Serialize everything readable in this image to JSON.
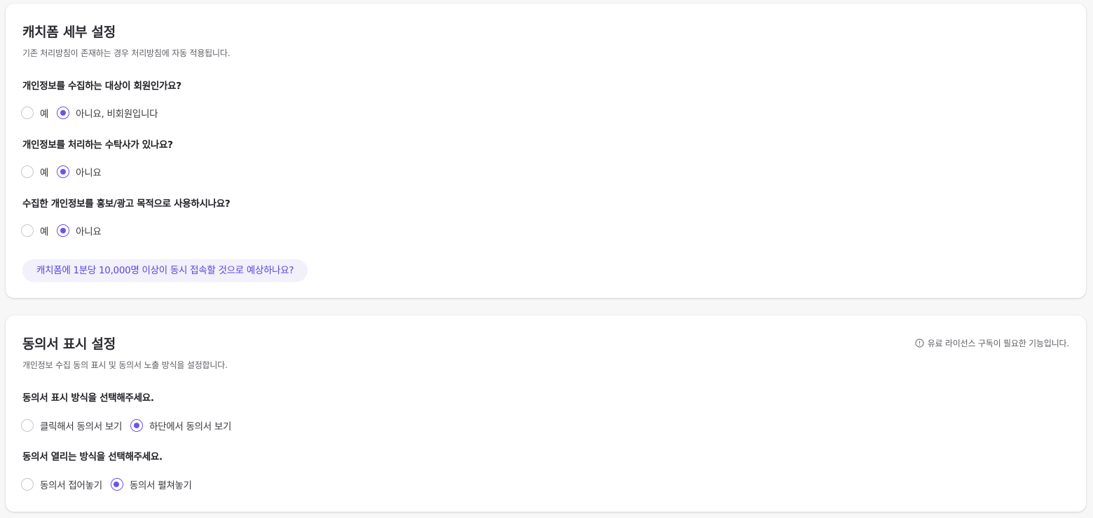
{
  "section1": {
    "title": "캐치폼 세부 설정",
    "description": "기존 처리방침이 존재하는 경우 처리방침에 자동 적용됩니다.",
    "questions": [
      {
        "label": "개인정보를 수집하는 대상이 회원인가요?",
        "options": [
          {
            "label": "예",
            "checked": false
          },
          {
            "label": "아니요, 비회원입니다",
            "checked": true
          }
        ]
      },
      {
        "label": "개인정보를 처리하는 수탁사가 있나요?",
        "options": [
          {
            "label": "예",
            "checked": false
          },
          {
            "label": "아니요",
            "checked": true
          }
        ]
      },
      {
        "label": "수집한 개인정보를 홍보/광고 목적으로 사용하시나요?",
        "options": [
          {
            "label": "예",
            "checked": false
          },
          {
            "label": "아니요",
            "checked": true
          }
        ]
      }
    ],
    "traffic_link": "캐치폼에 1분당 10,000명 이상이 동시 접속할 것으로 예상하나요?"
  },
  "section2": {
    "title": "동의서 표시 설정",
    "description": "개인정보 수집 동의 표시 및 동의서 노출 방식을 설정합니다.",
    "notice": "유료 라이선스 구독이 필요한 기능입니다.",
    "questions": [
      {
        "label": "동의서 표시 방식을 선택해주세요.",
        "options": [
          {
            "label": "클릭해서 동의서 보기",
            "checked": false
          },
          {
            "label": "하단에서 동의서 보기",
            "checked": true
          }
        ]
      },
      {
        "label": "동의서 열리는 방식을 선택해주세요.",
        "options": [
          {
            "label": "동의서 접어놓기",
            "checked": false
          },
          {
            "label": "동의서 펼쳐놓기",
            "checked": true
          }
        ]
      }
    ]
  },
  "colors": {
    "accent": "#6a55e8",
    "pill_bg": "#f1f0fb",
    "pill_text": "#5b48d8",
    "radio_border": "#c8c8ce"
  },
  "icons": {
    "notice": "info-circle-icon"
  }
}
